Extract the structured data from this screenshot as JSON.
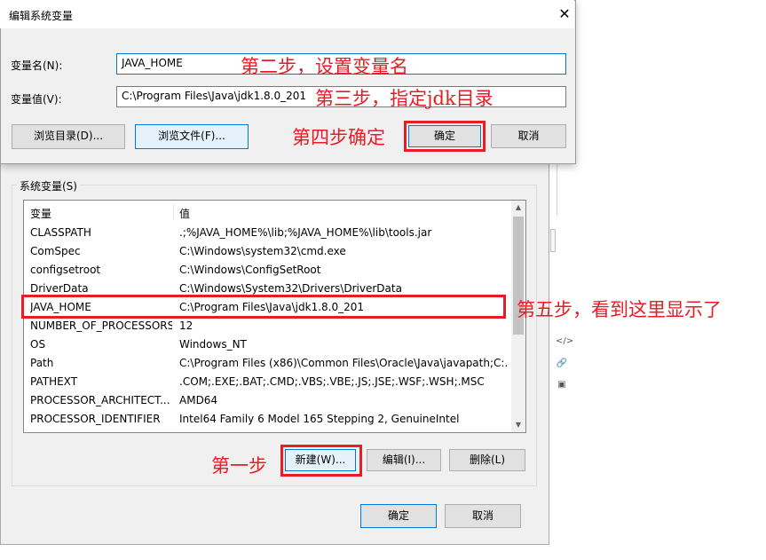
{
  "dialog": {
    "title": "编辑系统变量",
    "close_glyph": "✕",
    "name_label": "变量名(N):",
    "value_label": "变量值(V):",
    "name_value": "JAVA_HOME",
    "value_value": "C:\\Program Files\\Java\\jdk1.8.0_201",
    "browse_dir": "浏览目录(D)...",
    "browse_file": "浏览文件(F)...",
    "ok": "确定",
    "cancel": "取消"
  },
  "sysvars": {
    "group_label": "系统变量(S)",
    "headers": [
      "变量",
      "值"
    ],
    "rows": [
      {
        "name": "CLASSPATH",
        "value": ".;%JAVA_HOME%\\lib;%JAVA_HOME%\\lib\\tools.jar"
      },
      {
        "name": "ComSpec",
        "value": "C:\\Windows\\system32\\cmd.exe"
      },
      {
        "name": "configsetroot",
        "value": "C:\\Windows\\ConfigSetRoot"
      },
      {
        "name": "DriverData",
        "value": "C:\\Windows\\System32\\Drivers\\DriverData"
      },
      {
        "name": "JAVA_HOME",
        "value": "C:\\Program Files\\Java\\jdk1.8.0_201"
      },
      {
        "name": "NUMBER_OF_PROCESSORS",
        "value": "12"
      },
      {
        "name": "OS",
        "value": "Windows_NT"
      },
      {
        "name": "Path",
        "value": "C:\\Program Files (x86)\\Common Files\\Oracle\\Java\\javapath;C:..."
      },
      {
        "name": "PATHEXT",
        "value": ".COM;.EXE;.BAT;.CMD;.VBS;.VBE;.JS;.JSE;.WSF;.WSH;.MSC"
      },
      {
        "name": "PROCESSOR_ARCHITECT...",
        "value": "AMD64"
      },
      {
        "name": "PROCESSOR_IDENTIFIER",
        "value": "Intel64 Family 6 Model 165 Stepping 2, GenuineIntel"
      }
    ],
    "new_btn": "新建(W)...",
    "edit_btn": "编辑(I)...",
    "delete_btn": "删除(L)"
  },
  "footer": {
    "ok": "确定",
    "cancel": "取消"
  },
  "annotations": {
    "step1": "第一步",
    "step2": "第二步，设置变量名",
    "step3": "第三步，指定jdk目录",
    "step4": "第四步确定",
    "step5": "第五步，看到这里显示了"
  },
  "side_icons": [
    "</>",
    "🔗",
    "▣"
  ],
  "colors": {
    "annotation_red": "#e81c24",
    "accent_blue": "#0078d7"
  }
}
